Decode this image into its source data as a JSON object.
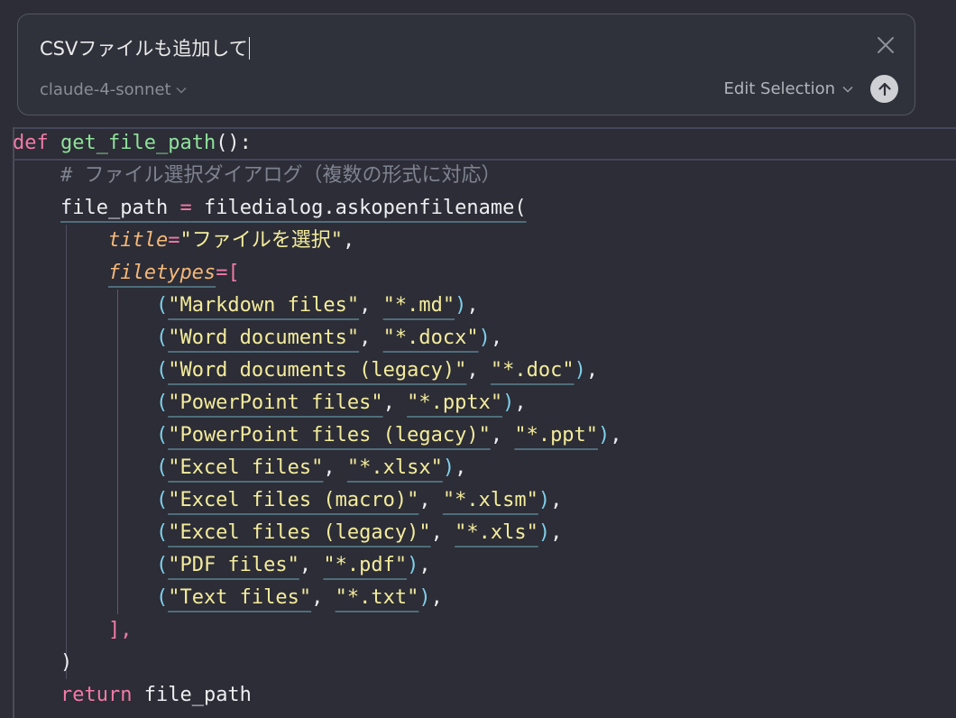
{
  "prompt": {
    "input_value": "CSVファイルも追加して",
    "model": "claude-4-sonnet",
    "edit_selection_label": "Edit Selection"
  },
  "code": {
    "def_kw": "def",
    "func_name": "get_file_path",
    "func_sig_tail": "():",
    "comment": "# ファイル選択ダイアログ（複数の形式に対応）",
    "assign_var": "file_path",
    "assign_op": "=",
    "call": "filedialog.askopenfilename(",
    "title_param": "title",
    "title_value": "\"ファイルを選択\"",
    "filetypes_param": "filetypes",
    "filetypes_open": "[",
    "filetypes": [
      {
        "label": "\"Markdown files\"",
        "ext": "\"*.md\""
      },
      {
        "label": "\"Word documents\"",
        "ext": "\"*.docx\""
      },
      {
        "label": "\"Word documents (legacy)\"",
        "ext": "\"*.doc\""
      },
      {
        "label": "\"PowerPoint files\"",
        "ext": "\"*.pptx\""
      },
      {
        "label": "\"PowerPoint files (legacy)\"",
        "ext": "\"*.ppt\""
      },
      {
        "label": "\"Excel files\"",
        "ext": "\"*.xlsx\""
      },
      {
        "label": "\"Excel files (macro)\"",
        "ext": "\"*.xlsm\""
      },
      {
        "label": "\"Excel files (legacy)\"",
        "ext": "\"*.xls\""
      },
      {
        "label": "\"PDF files\"",
        "ext": "\"*.pdf\""
      },
      {
        "label": "\"Text files\"",
        "ext": "\"*.txt\""
      }
    ],
    "filetypes_close": "],",
    "call_close": ")",
    "return_kw": "return",
    "return_value": "file_path"
  },
  "colors": {
    "keyword": "#f27aa8",
    "function": "#8fe29c",
    "string": "#f4ec9c",
    "parameter": "#f5b879",
    "comment": "#7f8290",
    "paren": "#7fd0ec"
  }
}
